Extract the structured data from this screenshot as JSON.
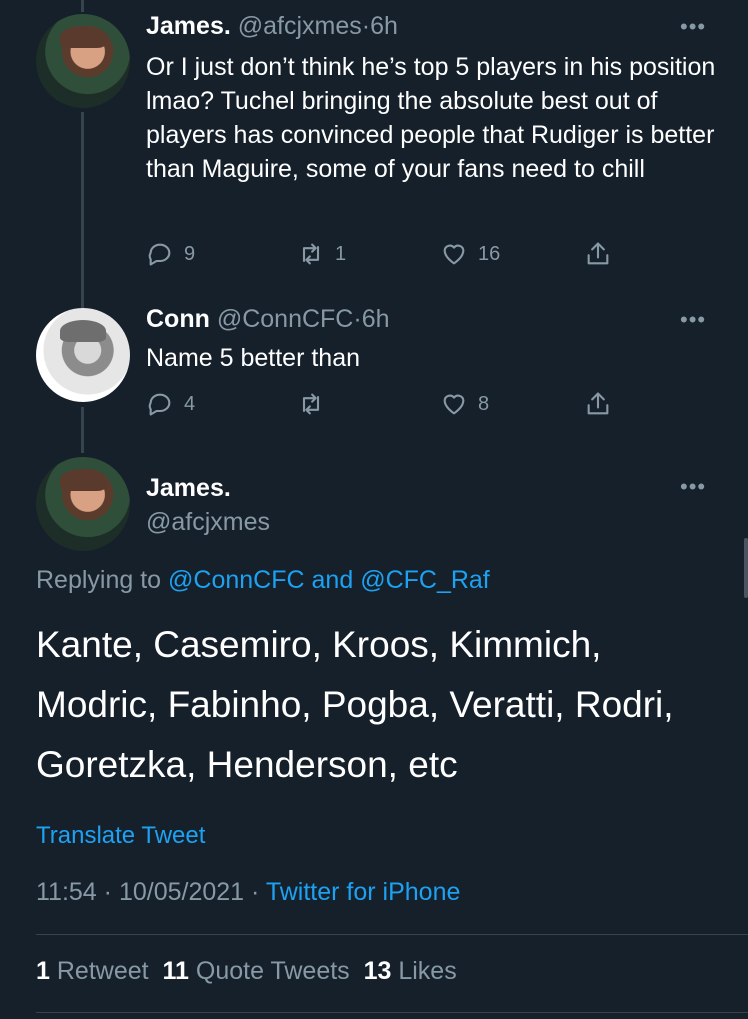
{
  "tweets": [
    {
      "display_name": "James.",
      "handle": "@afcjxmes",
      "time": "6h",
      "text": "Or I just don’t think he’s top 5 players in his position lmao? Tuchel bringing the absolute best out of players has convinced people that Rudiger is better than Maguire, some of your fans need to chill",
      "replies": "9",
      "retweets": "1",
      "likes": "16"
    },
    {
      "display_name": "Conn",
      "handle": "@ConnCFC",
      "time": "6h",
      "text": "Name 5 better than",
      "replies": "4",
      "retweets": "",
      "likes": "8"
    }
  ],
  "main_tweet": {
    "display_name": "James.",
    "handle": "@afcjxmes",
    "replying_prefix": "Replying to",
    "replying_user1": "@ConnCFC",
    "replying_and": "and",
    "replying_user2": "@CFC_Raf",
    "text": "Kante, Casemiro, Kroos, Kimmich, Modric, Fabinho, Pogba, Veratti, Rodri, Goretzka, Henderson, etc",
    "translate": "Translate Tweet",
    "time": "11:54",
    "date": "10/05/2021",
    "source": "Twitter for iPhone",
    "retweet_count": "1",
    "retweet_label": "Retweet",
    "quote_count": "11",
    "quote_label": "Quote Tweets",
    "like_count": "13",
    "like_label": "Likes"
  },
  "more_glyph": "•••",
  "sep": "·",
  "colors": {
    "background": "#15202b",
    "secondary": "#8899a6",
    "link": "#1da1f2",
    "line": "#38444d"
  }
}
